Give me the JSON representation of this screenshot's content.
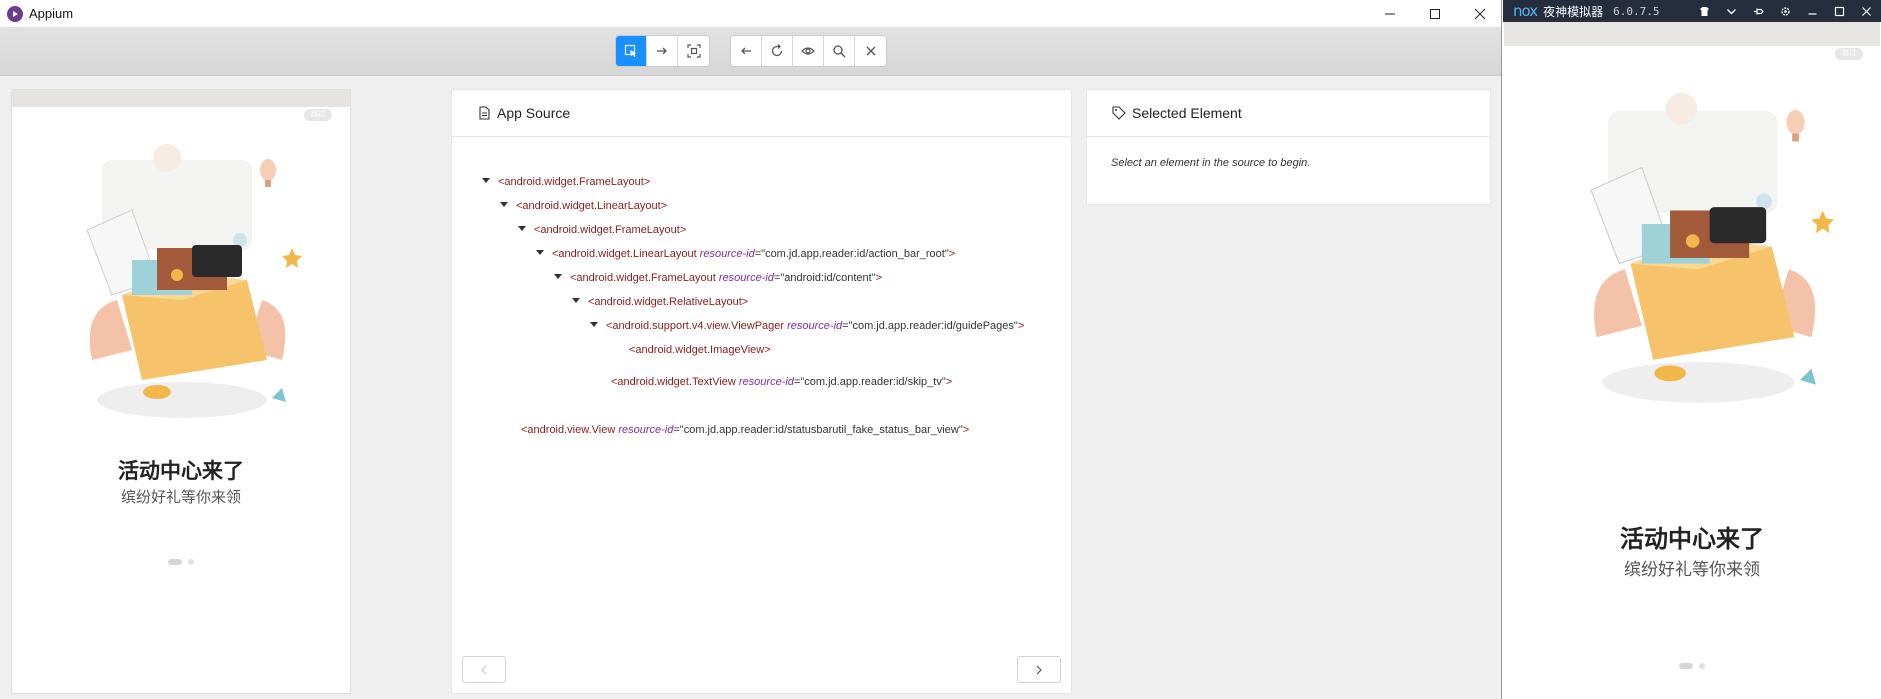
{
  "appium": {
    "title": "Appium",
    "window_controls": [
      "minimize-icon",
      "maximize-icon",
      "close-icon"
    ],
    "toolbar": {
      "group1": [
        "select-element-icon",
        "swipe-icon",
        "tap-coordinates-icon"
      ],
      "group2": [
        "back-icon",
        "refresh-icon",
        "eye-icon",
        "search-icon",
        "close-icon"
      ],
      "active_color": "#1890ff"
    },
    "device": {
      "skip_label": "跳过",
      "promo_title": "活动中心来了",
      "promo_subtitle": "缤纷好礼等你来领"
    },
    "source_panel": {
      "title": "App Source",
      "icon": "file-icon",
      "nodes": [
        {
          "caret": true,
          "tag": "<android.widget.FrameLayout>",
          "attr": "",
          "value": "",
          "close": ""
        },
        {
          "caret": true,
          "tag": "<android.widget.LinearLayout>",
          "attr": "",
          "value": "",
          "close": ""
        },
        {
          "caret": true,
          "tag": "<android.widget.FrameLayout>",
          "attr": "",
          "value": "",
          "close": ""
        },
        {
          "caret": true,
          "tag": "<android.widget.LinearLayout ",
          "attr": "resource-id",
          "value": "=\"com.jd.app.reader:id/action_bar_root\"",
          "close": ">"
        },
        {
          "caret": true,
          "tag": "<android.widget.FrameLayout ",
          "attr": "resource-id",
          "value": "=\"android:id/content\"",
          "close": ">"
        },
        {
          "caret": true,
          "tag": "<android.widget.RelativeLayout>",
          "attr": "",
          "value": "",
          "close": ""
        },
        {
          "caret": true,
          "tag": "<android.support.v4.view.ViewPager ",
          "attr": "resource-id",
          "value": "=\"com.jd.app.reader:id/guidePages\"",
          "close": ">"
        },
        {
          "caret": false,
          "tag": "<android.widget.ImageView>",
          "attr": "",
          "value": "",
          "close": ""
        },
        {
          "caret": false,
          "tag": "<android.widget.TextView ",
          "attr": "resource-id",
          "value": "=\"com.jd.app.reader:id/skip_tv\"",
          "close": ">"
        },
        {
          "caret": false,
          "tag": "<android.view.View ",
          "attr": "resource-id",
          "value": "=\"com.jd.app.reader:id/statusbarutil_fake_status_bar_view\"",
          "close": ">"
        }
      ]
    },
    "selected_panel": {
      "title": "Selected Element",
      "icon": "tag-icon",
      "hint": "Select an element in the source to begin."
    }
  },
  "nox": {
    "logo": "nox",
    "title": "夜神模拟器",
    "version": "6.0.7.5",
    "controls": [
      "shirt-icon",
      "chevron-down-icon",
      "pin-icon",
      "gear-icon",
      "minimize-icon",
      "maximize-icon",
      "close-icon"
    ],
    "skip_label": "跳过",
    "promo_title": "活动中心来了",
    "promo_subtitle": "缤纷好礼等你来领"
  }
}
